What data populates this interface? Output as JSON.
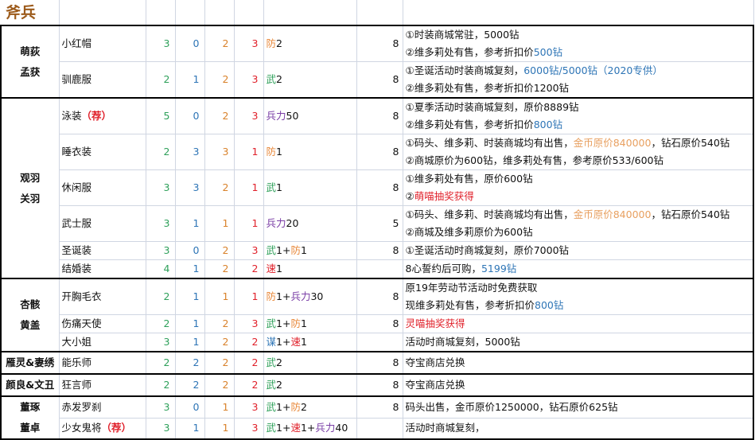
{
  "title": "斧兵",
  "colors": {
    "s0": "#2ea05a",
    "s1": "#2e75b6",
    "s2": "#d9822b",
    "s3": "#e0202a",
    "def": "#e8883a",
    "atk": "#2ea05a",
    "spd": "#e0202a",
    "int": "#2e75b6",
    "troop": "#7a3ea6",
    "blue": "#2e75b6",
    "orange": "#e8a060",
    "red": "#e0202a",
    "rec": "#e0202a",
    "text": "#111111"
  },
  "groups": [
    {
      "name_lines": [
        "萌荻",
        "孟获"
      ],
      "rows": [
        {
          "name": [
            {
              "t": "小红帽"
            }
          ],
          "stats": [
            "3",
            "0",
            "2",
            "3"
          ],
          "bonus": [
            {
              "t": "防",
              "c": "def"
            },
            {
              "t": "2"
            }
          ],
          "cost": "8",
          "notes": [
            [
              {
                "t": "①时装商城常驻，5000钻"
              }
            ],
            [
              {
                "t": "②维多莉处有售，参考折扣价"
              },
              {
                "t": "500钻",
                "c": "blue"
              }
            ]
          ]
        },
        {
          "name": [
            {
              "t": "驯鹿服"
            }
          ],
          "stats": [
            "2",
            "1",
            "2",
            "3"
          ],
          "bonus": [
            {
              "t": "武",
              "c": "atk"
            },
            {
              "t": "2"
            }
          ],
          "cost": "8",
          "notes": [
            [
              {
                "t": "①圣诞活动时装商城复刻，"
              },
              {
                "t": "6000钻/5000钻（2020专供）",
                "c": "blue"
              }
            ],
            [
              {
                "t": "②维多莉处有售，参考折扣价1200钻"
              }
            ]
          ]
        }
      ]
    },
    {
      "name_lines": [
        "观羽",
        "关羽"
      ],
      "rows": [
        {
          "name": [
            {
              "t": "泳装"
            },
            {
              "t": "（荐）",
              "c": "rec",
              "b": true
            }
          ],
          "stats": [
            "5",
            "0",
            "2",
            "3"
          ],
          "bonus": [
            {
              "t": "兵力",
              "c": "troop"
            },
            {
              "t": "50"
            }
          ],
          "cost": "8",
          "notes": [
            [
              {
                "t": "①夏季活动时装商城复刻，原价8889钻"
              }
            ],
            [
              {
                "t": "②维多莉处有售，参考折扣价"
              },
              {
                "t": "800钻",
                "c": "blue"
              }
            ]
          ]
        },
        {
          "name": [
            {
              "t": "睡衣装"
            }
          ],
          "stats": [
            "2",
            "3",
            "3",
            "1"
          ],
          "bonus": [
            {
              "t": "防",
              "c": "def"
            },
            {
              "t": "1"
            }
          ],
          "cost": "8",
          "notes": [
            [
              {
                "t": "①码头、维多莉、时装商城均有出售，"
              },
              {
                "t": "金币原价840000",
                "c": "orange"
              },
              {
                "t": "，钻石原价540钻"
              }
            ],
            [
              {
                "t": "②商城原价为600钻，维多莉处有售，参考原价533/600钻"
              }
            ]
          ]
        },
        {
          "name": [
            {
              "t": "休闲服"
            }
          ],
          "stats": [
            "3",
            "3",
            "2",
            "1"
          ],
          "bonus": [
            {
              "t": "武",
              "c": "atk"
            },
            {
              "t": "1"
            }
          ],
          "cost": "8",
          "notes": [
            [
              {
                "t": "①维多莉处有售，原价600钻"
              }
            ],
            [
              {
                "t": "②"
              },
              {
                "t": "萌喵抽奖获得",
                "c": "red"
              }
            ]
          ]
        },
        {
          "name": [
            {
              "t": "武士服"
            }
          ],
          "stats": [
            "3",
            "1",
            "1",
            "1"
          ],
          "bonus": [
            {
              "t": "兵力",
              "c": "troop"
            },
            {
              "t": "20"
            }
          ],
          "cost": "5",
          "notes": [
            [
              {
                "t": "①码头、维多莉、时装商城均有出售，"
              },
              {
                "t": "金币原价840000",
                "c": "orange"
              },
              {
                "t": "，钻石原价540钻"
              }
            ],
            [
              {
                "t": "②商城及维多莉原价为600钻"
              }
            ]
          ]
        },
        {
          "name": [
            {
              "t": "圣诞装"
            }
          ],
          "stats": [
            "3",
            "0",
            "2",
            "3"
          ],
          "bonus": [
            {
              "t": "武",
              "c": "atk"
            },
            {
              "t": "1+"
            },
            {
              "t": "防",
              "c": "def"
            },
            {
              "t": "1"
            }
          ],
          "cost": "8",
          "notes": [
            [
              {
                "t": "①圣诞活动时商城复刻，原价7000钻"
              }
            ]
          ]
        },
        {
          "name": [
            {
              "t": "结婚装"
            }
          ],
          "stats": [
            "4",
            "1",
            "2",
            "2"
          ],
          "bonus": [
            {
              "t": "速",
              "c": "spd"
            },
            {
              "t": "1"
            }
          ],
          "cost": "",
          "notes": [
            [
              {
                "t": "8心誓约后可购，"
              },
              {
                "t": "5199钻",
                "c": "blue"
              }
            ]
          ]
        }
      ]
    },
    {
      "name_lines": [
        "杏骸",
        "黄盖"
      ],
      "rows": [
        {
          "name": [
            {
              "t": "开胸毛衣"
            }
          ],
          "stats": [
            "2",
            "1",
            "1",
            "1"
          ],
          "bonus": [
            {
              "t": "防",
              "c": "def"
            },
            {
              "t": "1+"
            },
            {
              "t": "兵力",
              "c": "troop"
            },
            {
              "t": "30"
            }
          ],
          "cost": "8",
          "notes": [
            [
              {
                "t": "原19年劳动节活动时免费获取"
              }
            ],
            [
              {
                "t": "现维多莉处有售，参考折扣价"
              },
              {
                "t": "800钻",
                "c": "blue"
              }
            ]
          ]
        },
        {
          "name": [
            {
              "t": "伤痛天使"
            }
          ],
          "stats": [
            "2",
            "1",
            "2",
            "3"
          ],
          "bonus": [
            {
              "t": "武",
              "c": "atk"
            },
            {
              "t": "1+"
            },
            {
              "t": "防",
              "c": "def"
            },
            {
              "t": "1"
            }
          ],
          "cost": "8",
          "notes": [
            [
              {
                "t": "灵喵抽奖获得",
                "c": "red"
              }
            ]
          ]
        },
        {
          "name": [
            {
              "t": "大小姐"
            }
          ],
          "stats": [
            "3",
            "1",
            "2",
            "2"
          ],
          "bonus": [
            {
              "t": "谋",
              "c": "int"
            },
            {
              "t": "1+"
            },
            {
              "t": "速",
              "c": "spd"
            },
            {
              "t": "1"
            }
          ],
          "cost": "",
          "notes": [
            [
              {
                "t": "活动时商城复刻，5000钻"
              }
            ]
          ]
        }
      ]
    },
    {
      "name_lines": [
        "雁灵&妻绣"
      ],
      "rows": [
        {
          "name": [
            {
              "t": "能乐师"
            }
          ],
          "stats": [
            "2",
            "2",
            "2",
            "2"
          ],
          "bonus": [
            {
              "t": "武",
              "c": "atk"
            },
            {
              "t": "2"
            }
          ],
          "cost": "8",
          "notes": [
            [
              {
                "t": "夺宝商店兑换"
              }
            ]
          ]
        }
      ]
    },
    {
      "name_lines": [
        "颜良&文丑"
      ],
      "rows": [
        {
          "name": [
            {
              "t": "狂言师"
            }
          ],
          "stats": [
            "2",
            "2",
            "2",
            "2"
          ],
          "bonus": [
            {
              "t": "武",
              "c": "atk"
            },
            {
              "t": "2"
            }
          ],
          "cost": "8",
          "notes": [
            [
              {
                "t": "夺宝商店兑换"
              }
            ]
          ]
        }
      ]
    },
    {
      "name_lines": [
        "董琢",
        "董卓"
      ],
      "rows": [
        {
          "name": [
            {
              "t": "赤发罗刹"
            }
          ],
          "stats": [
            "3",
            "0",
            "1",
            "3"
          ],
          "bonus": [
            {
              "t": "武",
              "c": "atk"
            },
            {
              "t": "1+"
            },
            {
              "t": "防",
              "c": "def"
            },
            {
              "t": "2"
            }
          ],
          "cost": "8",
          "notes": [
            [
              {
                "t": "码头出售，金币原价1250000，钻石原价625钻"
              }
            ]
          ]
        },
        {
          "name": [
            {
              "t": "少女鬼将"
            },
            {
              "t": "（荐）",
              "c": "rec",
              "b": true
            }
          ],
          "stats": [
            "3",
            "1",
            "1",
            "3"
          ],
          "bonus": [
            {
              "t": "武",
              "c": "atk"
            },
            {
              "t": "1+"
            },
            {
              "t": "速",
              "c": "spd"
            },
            {
              "t": "1+"
            },
            {
              "t": "兵力",
              "c": "troop"
            },
            {
              "t": "40"
            }
          ],
          "cost": "",
          "notes": [
            [
              {
                "t": "活动时商城复刻，"
              }
            ]
          ]
        }
      ]
    }
  ]
}
